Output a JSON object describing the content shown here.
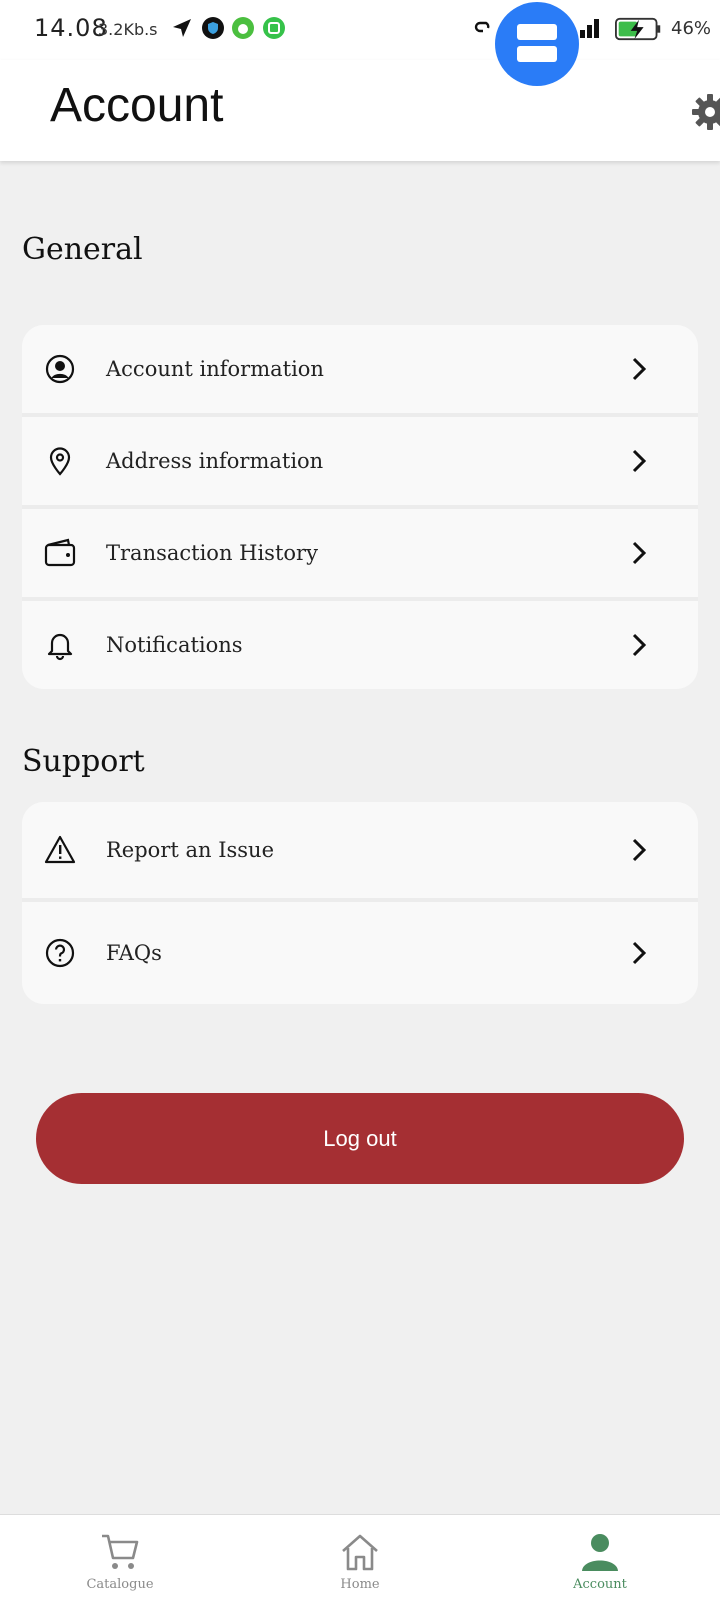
{
  "status_bar": {
    "time": "14.08",
    "speed": "3.2Kb.s",
    "battery": "46%"
  },
  "header": {
    "title": "Account",
    "settings_icon": "gear-icon"
  },
  "general": {
    "title": "General",
    "items": [
      {
        "label": "Account information",
        "icon": "user-circle-icon"
      },
      {
        "label": "Address information",
        "icon": "location-pin-icon"
      },
      {
        "label": "Transaction History",
        "icon": "wallet-icon"
      },
      {
        "label": "Notifications",
        "icon": "bell-icon"
      }
    ]
  },
  "support": {
    "title": "Support",
    "items": [
      {
        "label": "Report an Issue",
        "icon": "warning-icon"
      },
      {
        "label": "FAQs",
        "icon": "question-circle-icon"
      }
    ]
  },
  "logout": {
    "label": "Log out",
    "color": "#a52f33"
  },
  "bottom_nav": {
    "items": [
      {
        "label": "Catalogue",
        "icon": "cart-icon",
        "active": false
      },
      {
        "label": "Home",
        "icon": "home-icon",
        "active": false
      },
      {
        "label": "Account",
        "icon": "person-icon",
        "active": true
      }
    ],
    "active_color": "#4a8c5f"
  }
}
